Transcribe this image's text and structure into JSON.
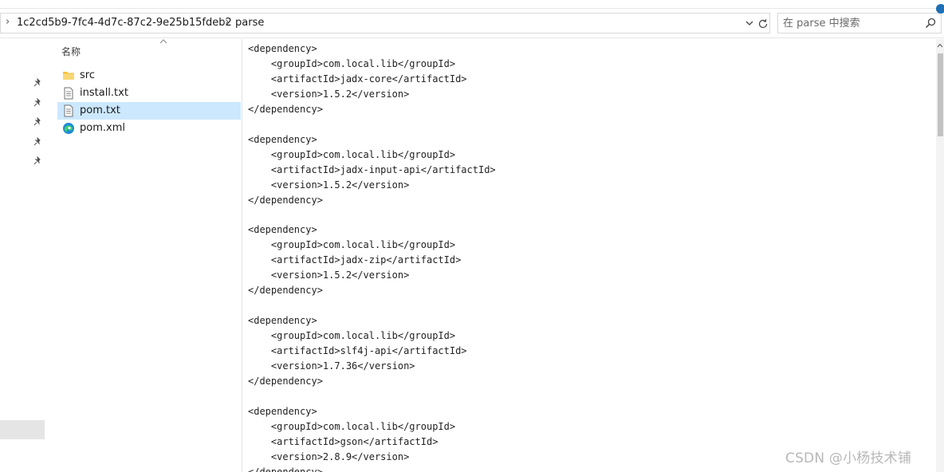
{
  "address_bar": {
    "path": [
      "1c2cd5b9-7fc4-4d7c-87c2-9e25b15fdeb2",
      "parse"
    ],
    "search_placeholder": "在 parse 中搜索"
  },
  "file_list": {
    "column_name": "名称",
    "items": [
      {
        "name": "src",
        "icon": "folder-icon",
        "selected": false
      },
      {
        "name": "install.txt",
        "icon": "text-file-icon",
        "selected": false
      },
      {
        "name": "pom.txt",
        "icon": "text-file-icon",
        "selected": true
      },
      {
        "name": "pom.xml",
        "icon": "edge-icon",
        "selected": false
      }
    ]
  },
  "preview": {
    "lines": [
      "<dependency>",
      "    <groupId>com.local.lib</groupId>",
      "    <artifactId>jadx-core</artifactId>",
      "    <version>1.5.2</version>",
      "</dependency>",
      "",
      "<dependency>",
      "    <groupId>com.local.lib</groupId>",
      "    <artifactId>jadx-input-api</artifactId>",
      "    <version>1.5.2</version>",
      "</dependency>",
      "",
      "<dependency>",
      "    <groupId>com.local.lib</groupId>",
      "    <artifactId>jadx-zip</artifactId>",
      "    <version>1.5.2</version>",
      "</dependency>",
      "",
      "<dependency>",
      "    <groupId>com.local.lib</groupId>",
      "    <artifactId>slf4j-api</artifactId>",
      "    <version>1.7.36</version>",
      "</dependency>",
      "",
      "<dependency>",
      "    <groupId>com.local.lib</groupId>",
      "    <artifactId>gson</artifactId>",
      "    <version>2.8.9</version>",
      "</dependency>"
    ]
  },
  "watermark": "CSDN @小杨技术铺",
  "colors": {
    "selection": "#cce8ff",
    "folder": "#f3c13a",
    "accent": "#1f6fb3"
  }
}
